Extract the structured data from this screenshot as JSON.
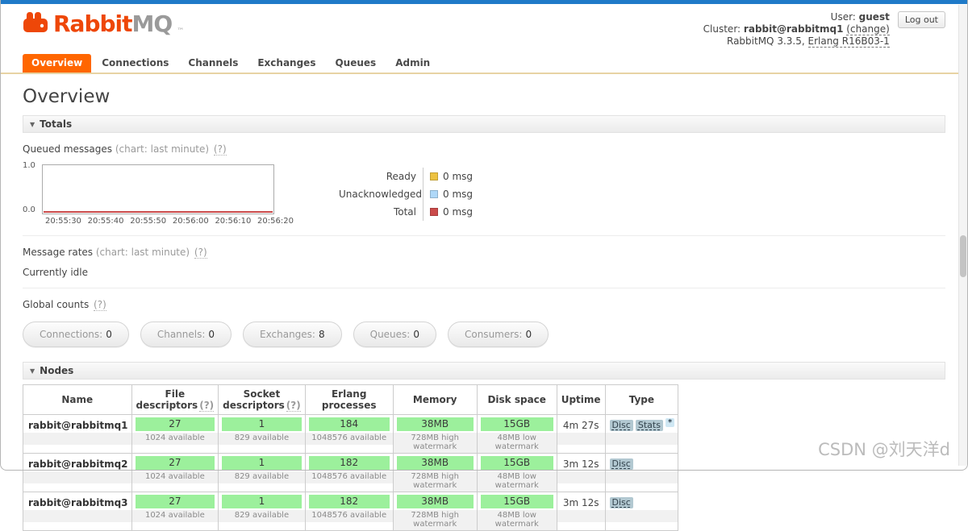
{
  "header": {
    "logo_rabbit": "Rabbit",
    "logo_mq": "MQ",
    "logo_tm": "™",
    "user_label": "User:",
    "user_value": "guest",
    "logout_button": "Log out",
    "cluster_label": "Cluster:",
    "cluster_value": "rabbit@rabbitmq1",
    "cluster_change_link": "(change)",
    "version_prefix": "RabbitMQ 3.3.5,",
    "erlang_link": "Erlang R16B03-1"
  },
  "tabs": [
    {
      "label": "Overview"
    },
    {
      "label": "Connections"
    },
    {
      "label": "Channels"
    },
    {
      "label": "Exchanges"
    },
    {
      "label": "Queues"
    },
    {
      "label": "Admin"
    }
  ],
  "page_title": "Overview",
  "totals": {
    "title": "Totals",
    "queued": {
      "label": "Queued messages",
      "hint": "(chart: last minute)",
      "help": "(?)"
    },
    "message_rates": {
      "label": "Message rates",
      "hint": "(chart: last minute)",
      "help": "(?)",
      "status": "Currently idle"
    },
    "global_counts": {
      "label": "Global counts",
      "help": "(?)"
    },
    "counts": [
      {
        "label": "Connections:",
        "value": "0"
      },
      {
        "label": "Channels:",
        "value": "0"
      },
      {
        "label": "Exchanges:",
        "value": "8"
      },
      {
        "label": "Queues:",
        "value": "0"
      },
      {
        "label": "Consumers:",
        "value": "0"
      }
    ]
  },
  "chart_data": {
    "type": "line",
    "title": "Queued messages (chart: last minute)",
    "x": [
      "20:55:30",
      "20:55:40",
      "20:55:50",
      "20:56:00",
      "20:56:10",
      "20:56:20"
    ],
    "ylim": [
      0.0,
      1.0
    ],
    "y_tick_labels": {
      "top": "1.0",
      "bottom": "0.0"
    },
    "grid": false,
    "legend_position": "right",
    "series": [
      {
        "name": "Ready",
        "values": [
          0,
          0,
          0,
          0,
          0,
          0
        ],
        "display": "0 msg",
        "color": "#edc240"
      },
      {
        "name": "Unacknowledged",
        "values": [
          0,
          0,
          0,
          0,
          0,
          0
        ],
        "display": "0 msg",
        "color": "#afd8f8"
      },
      {
        "name": "Total",
        "values": [
          0,
          0,
          0,
          0,
          0,
          0
        ],
        "display": "0 msg",
        "color": "#cb4b4b"
      }
    ]
  },
  "nodes": {
    "title": "Nodes",
    "columns": [
      {
        "label": "Name",
        "help": ""
      },
      {
        "label": "File descriptors",
        "help": "(?)"
      },
      {
        "label": "Socket descriptors",
        "help": "(?)"
      },
      {
        "label": "Erlang processes",
        "help": ""
      },
      {
        "label": "Memory",
        "help": ""
      },
      {
        "label": "Disk space",
        "help": ""
      },
      {
        "label": "Uptime",
        "help": ""
      },
      {
        "label": "Type",
        "help": ""
      }
    ],
    "rows": [
      {
        "name": "rabbit@rabbitmq1",
        "file_descriptors": {
          "value": "27",
          "sub": "1024 available"
        },
        "socket_descriptors": {
          "value": "1",
          "sub": "829 available"
        },
        "erlang_processes": {
          "value": "184",
          "sub": "1048576 available"
        },
        "memory": {
          "value": "38MB",
          "sub": "728MB high watermark"
        },
        "disk_space": {
          "value": "15GB",
          "sub": "48MB low watermark"
        },
        "uptime": "4m 27s",
        "types": [
          "Disc",
          "Stats",
          "*"
        ]
      },
      {
        "name": "rabbit@rabbitmq2",
        "file_descriptors": {
          "value": "27",
          "sub": "1024 available"
        },
        "socket_descriptors": {
          "value": "1",
          "sub": "829 available"
        },
        "erlang_processes": {
          "value": "182",
          "sub": "1048576 available"
        },
        "memory": {
          "value": "38MB",
          "sub": "728MB high watermark"
        },
        "disk_space": {
          "value": "15GB",
          "sub": "48MB low watermark"
        },
        "uptime": "3m 12s",
        "types": [
          "Disc"
        ]
      },
      {
        "name": "rabbit@rabbitmq3",
        "file_descriptors": {
          "value": "27",
          "sub": "1024 available"
        },
        "socket_descriptors": {
          "value": "1",
          "sub": "829 available"
        },
        "erlang_processes": {
          "value": "182",
          "sub": "1048576 available"
        },
        "memory": {
          "value": "38MB",
          "sub": "728MB high watermark"
        },
        "disk_space": {
          "value": "15GB",
          "sub": "48MB low watermark"
        },
        "uptime": "3m 12s",
        "types": [
          "Disc"
        ]
      }
    ]
  },
  "colors": {
    "accent_orange": "#ff6600",
    "topbar_blue": "#1f7ac8",
    "usage_bar_green": "#9cf09c",
    "node_badge_blue": "#b2c8d1",
    "stats_star_blue": "#cfe7f3"
  },
  "watermark": "CSDN @刘天洋d"
}
